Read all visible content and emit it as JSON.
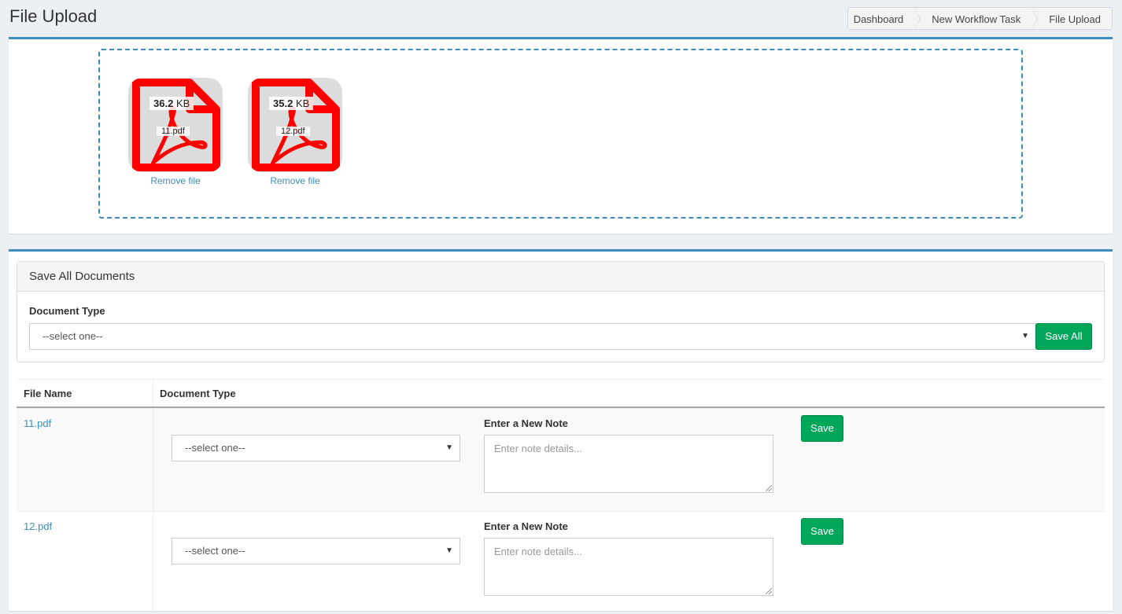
{
  "header": {
    "title": "File Upload"
  },
  "breadcrumb": [
    "Dashboard",
    "New Workflow Task",
    "File Upload"
  ],
  "dropzone": {
    "files": [
      {
        "size_value": "36.2",
        "size_unit": "KB",
        "name": "11.pdf",
        "remove_label": "Remove file"
      },
      {
        "size_value": "35.2",
        "size_unit": "KB",
        "name": "12.pdf",
        "remove_label": "Remove file"
      }
    ]
  },
  "save_all_panel": {
    "heading": "Save All Documents",
    "label": "Document Type",
    "select_value": "--select one--",
    "button_label": "Save All"
  },
  "table": {
    "headers": [
      "File Name",
      "Document Type"
    ],
    "rows": [
      {
        "file_name": "11.pdf",
        "doc_type": "--select one--",
        "note_label": "Enter a New Note",
        "note_placeholder": "Enter note details...",
        "save_label": "Save"
      },
      {
        "file_name": "12.pdf",
        "doc_type": "--select one--",
        "note_label": "Enter a New Note",
        "note_placeholder": "Enter note details...",
        "save_label": "Save"
      }
    ]
  },
  "colors": {
    "accent": "#3c8dbc",
    "success": "#00a65a",
    "pdf_red": "#ff0000"
  },
  "icons": {
    "file": "pdf-file-icon",
    "dropdown": "caret-down-icon"
  }
}
